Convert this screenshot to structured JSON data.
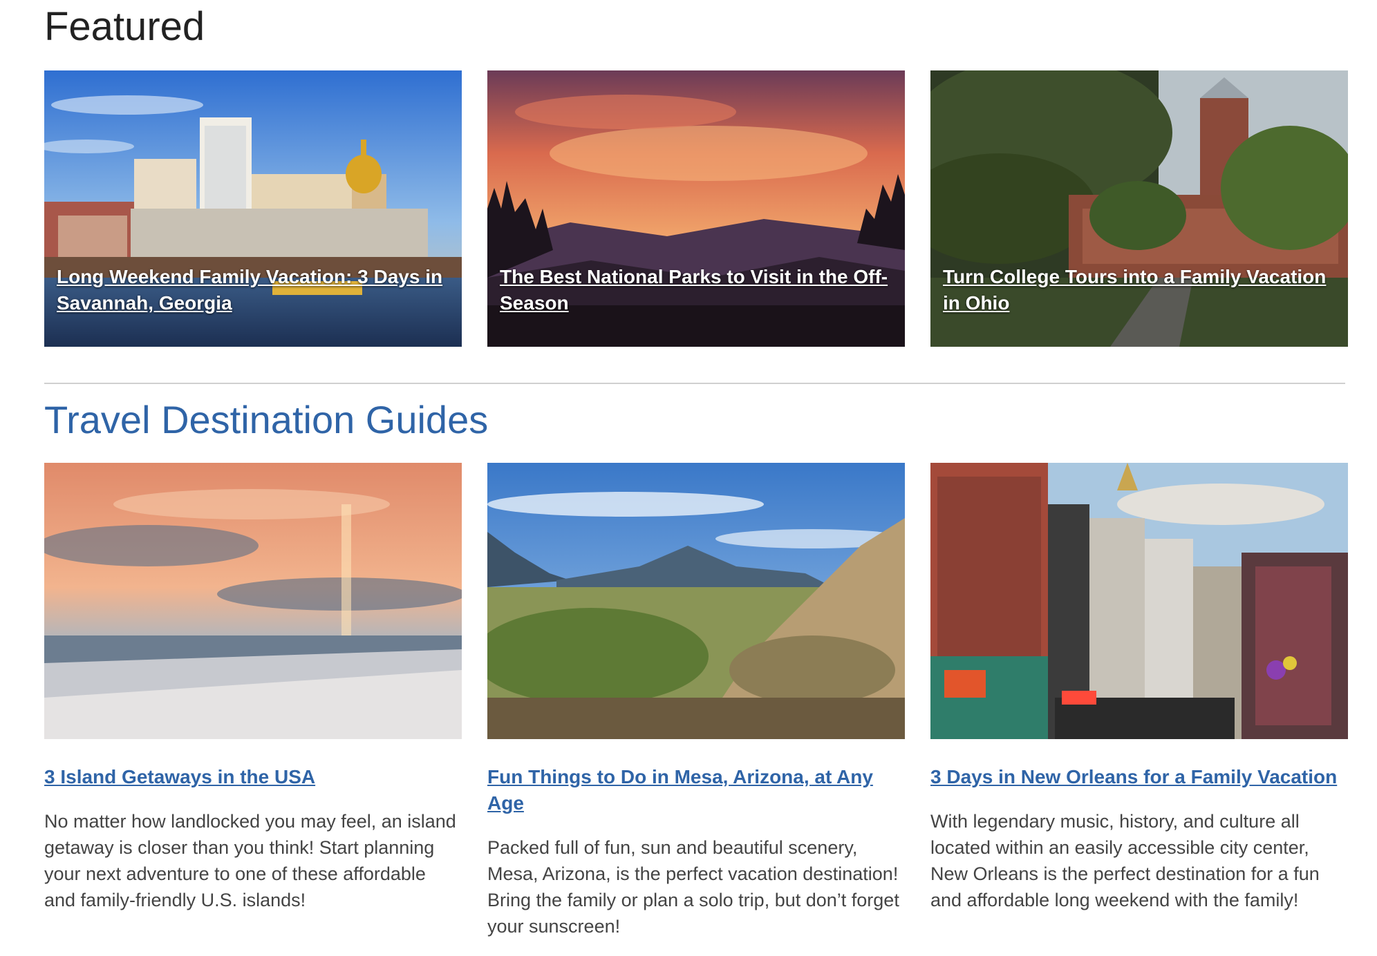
{
  "featured": {
    "title": "Featured",
    "cards": [
      {
        "link": "Long Weekend Family Vacation: 3 Days in Savannah, Georgia",
        "image": "savannah-skyline-photo"
      },
      {
        "link": "The Best National Parks to Visit in the Off-Season",
        "image": "mountain-sunset-photo"
      },
      {
        "link": "Turn College Tours into a Family Vacation in Ohio",
        "image": "college-campus-photo"
      }
    ]
  },
  "guides": {
    "title": "Travel Destination Guides",
    "cards": [
      {
        "link": "3 Island Getaways in the USA",
        "description": "No matter how landlocked you may feel, an island getaway is closer than you think! Start planning your next adventure to one of these affordable and family-friendly U.S. islands!",
        "image": "beach-sunset-photo"
      },
      {
        "link": "Fun Things to Do in Mesa, Arizona, at Any Age",
        "description": "Packed full of fun, sun and beautiful scenery, Mesa, Arizona, is the perfect vacation destination! Bring the family or plan a solo trip, but don’t forget your sunscreen!",
        "image": "desert-mountains-photo"
      },
      {
        "link": "3 Days in New Orleans for a Family Vacation",
        "description": "With legendary music, history, and culture all located within an easily accessible city center, New Orleans is the perfect destination for a fun and affordable long weekend with the family!",
        "image": "french-quarter-street-photo"
      }
    ]
  },
  "colors": {
    "accent": "#2f64a7",
    "heading": "#222222",
    "body_text": "#444444",
    "divider": "#d0d0d0"
  }
}
